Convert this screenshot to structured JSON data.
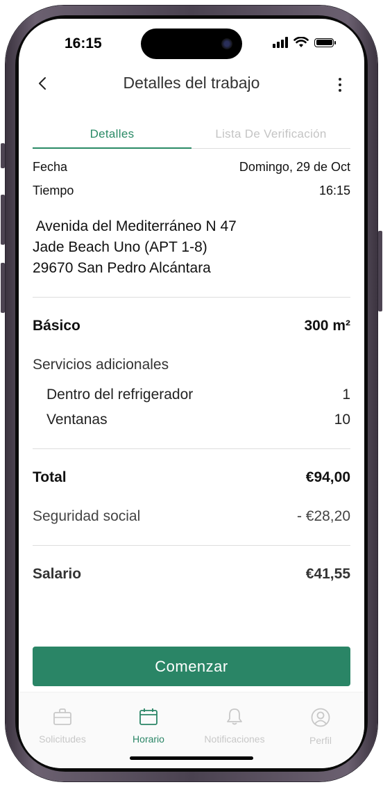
{
  "status_bar": {
    "time": "16:15"
  },
  "header": {
    "title": "Detalles del trabajo"
  },
  "tabs": [
    {
      "label": "Detalles",
      "active": true
    },
    {
      "label": "Lista De Verificación",
      "active": false
    }
  ],
  "details": {
    "date_label": "Fecha",
    "date_value": "Domingo, 29 de Oct",
    "time_label": "Tiempo",
    "time_value": "16:15",
    "address": [
      " Avenida del Mediterráneo N 47",
      "Jade Beach Uno (APT 1-8)",
      "29670 San Pedro Alcántara"
    ]
  },
  "service": {
    "basic_label": "Básico",
    "basic_value": "300 m²",
    "additional_label": "Servicios adicionales",
    "items": [
      {
        "label": "Dentro del refrigerador",
        "value": "1"
      },
      {
        "label": "Ventanas",
        "value": "10"
      }
    ]
  },
  "totals": {
    "total_label": "Total",
    "total_value": "€94,00",
    "social_label": "Seguridad social",
    "social_value": "- €28,20",
    "salary_label": "Salario",
    "salary_value": "€41,55"
  },
  "action": {
    "start_label": "Comenzar"
  },
  "tabbar": [
    {
      "label": "Solicitudes",
      "icon": "briefcase-icon",
      "active": false
    },
    {
      "label": "Horario",
      "icon": "calendar-icon",
      "active": true
    },
    {
      "label": "Notificaciones",
      "icon": "bell-icon",
      "active": false
    },
    {
      "label": "Perfil",
      "icon": "user-icon",
      "active": false
    }
  ],
  "colors": {
    "accent": "#2a8566",
    "inactive": "#c8c8c8"
  }
}
